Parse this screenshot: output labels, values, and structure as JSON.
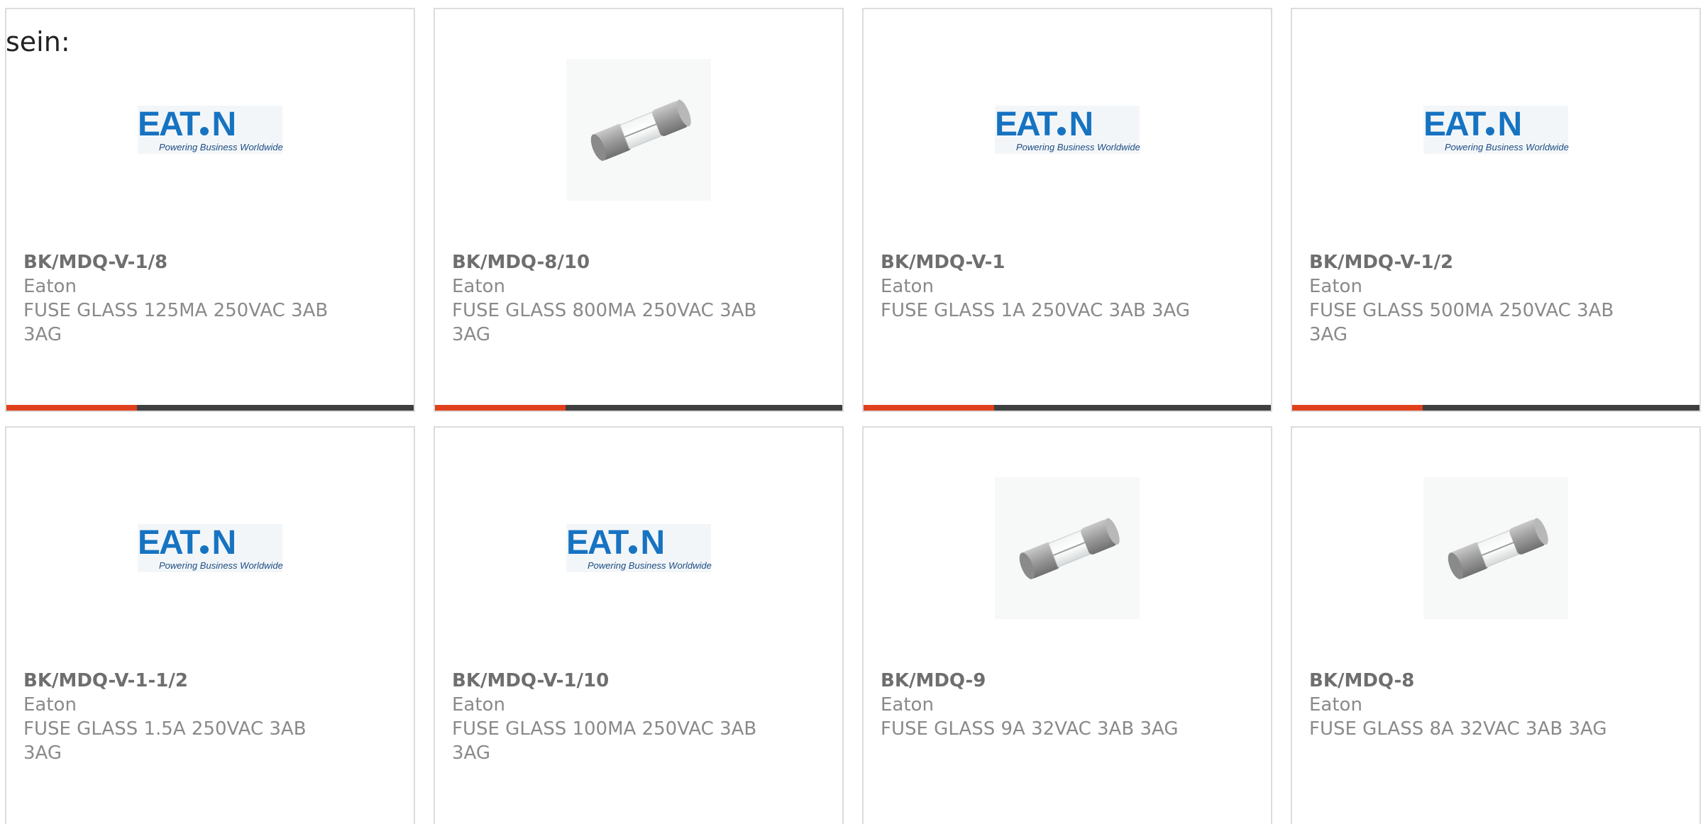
{
  "intro_text": "sein:",
  "colors": {
    "accent_bar": "#e0401b",
    "bar_base": "#3d3f41",
    "card_border": "#dcdcdc",
    "eaton_blue": "#1673c2"
  },
  "eaton_logo": {
    "brand": "EATON",
    "tagline": "Powering Business Worldwide"
  },
  "products": [
    {
      "part_number": "BK/MDQ-V-1/8",
      "manufacturer": "Eaton",
      "description": "FUSE GLASS 125MA 250VAC 3AB 3AG",
      "image": "eaton-logo",
      "progress": 0.32
    },
    {
      "part_number": "BK/MDQ-8/10",
      "manufacturer": "Eaton",
      "description": "FUSE GLASS 800MA 250VAC 3AB 3AG",
      "image": "glass-fuse-photo",
      "progress": 0.32
    },
    {
      "part_number": "BK/MDQ-V-1",
      "manufacturer": "Eaton",
      "description": "FUSE GLASS 1A 250VAC 3AB 3AG",
      "image": "eaton-logo",
      "progress": 0.32
    },
    {
      "part_number": "BK/MDQ-V-1/2",
      "manufacturer": "Eaton",
      "description": "FUSE GLASS 500MA 250VAC 3AB 3AG",
      "image": "eaton-logo",
      "progress": 0.32
    },
    {
      "part_number": "BK/MDQ-V-1-1/2",
      "manufacturer": "Eaton",
      "description": "FUSE GLASS 1.5A 250VAC 3AB 3AG",
      "image": "eaton-logo"
    },
    {
      "part_number": "BK/MDQ-V-1/10",
      "manufacturer": "Eaton",
      "description": "FUSE GLASS 100MA 250VAC 3AB 3AG",
      "image": "eaton-logo"
    },
    {
      "part_number": "BK/MDQ-9",
      "manufacturer": "Eaton",
      "description": "FUSE GLASS 9A 32VAC 3AB 3AG",
      "image": "glass-fuse-photo"
    },
    {
      "part_number": "BK/MDQ-8",
      "manufacturer": "Eaton",
      "description": "FUSE GLASS 8A 32VAC 3AB 3AG",
      "image": "glass-fuse-photo"
    }
  ]
}
